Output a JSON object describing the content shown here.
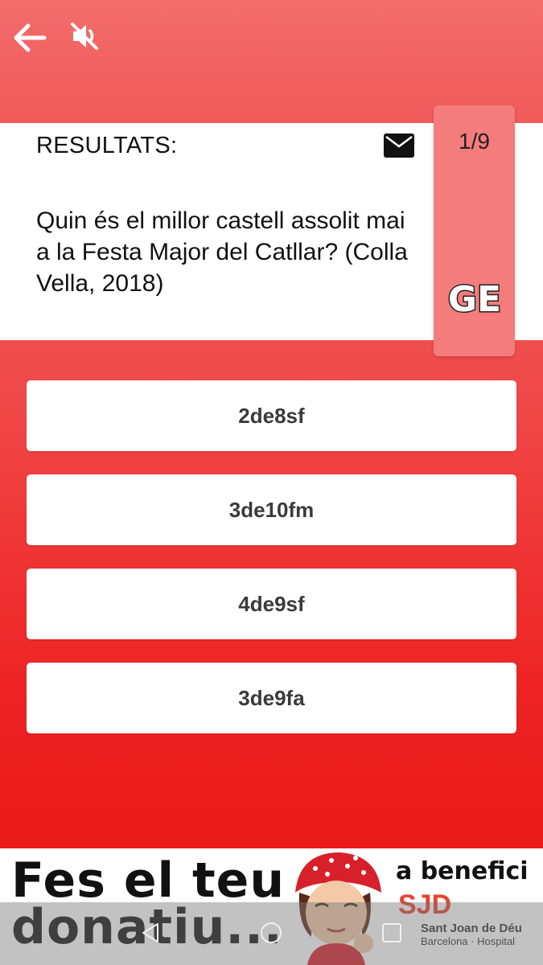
{
  "header": {
    "back_icon": "arrow-left-icon",
    "mute_icon": "volume-off-icon"
  },
  "question": {
    "results_label": "RESULTATS:",
    "mail_icon": "mail-icon",
    "text": "Quin és el millor castell assolit mai a la Festa Major del Catllar? (Colla Vella, 2018)"
  },
  "side_card": {
    "counter": "1/9",
    "level": "GE"
  },
  "answers": [
    {
      "label": "2de8sf"
    },
    {
      "label": "3de10fm"
    },
    {
      "label": "4de9sf"
    },
    {
      "label": "3de9fa"
    }
  ],
  "banner": {
    "line1": "Fes el teu",
    "line2": "donatiu...",
    "benefit": "a benefici",
    "sjd": "SJD",
    "hospital_name": "Sant Joan de Déu",
    "hospital_city": "Barcelona · Hospital"
  },
  "navbar": {
    "back": "triangle-back-icon",
    "home": "circle-home-icon",
    "recent": "square-recent-icon"
  },
  "colors": {
    "top_red": "#f36c6c",
    "bottom_red": "#e81010",
    "side_card": "#f47c7c",
    "sjd_red": "#e8432f"
  }
}
